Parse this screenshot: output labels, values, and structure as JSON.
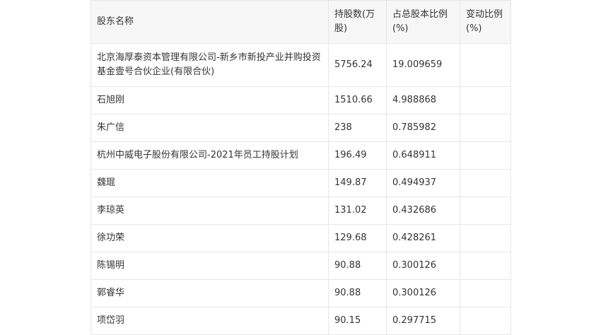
{
  "table": {
    "headers": [
      "股东名称",
      "持股数(万股)",
      "占总股本比例(%)",
      "变动比例(%)"
    ],
    "rows": [
      {
        "name": "北京海厚泰资本管理有限公司-新乡市新投产业并购投资基金壹号合伙企业(有限合伙)",
        "shares": "5756.24",
        "ratio": "19.009659",
        "change": ""
      },
      {
        "name": "石旭刚",
        "shares": "1510.66",
        "ratio": "4.988868",
        "change": ""
      },
      {
        "name": "朱广信",
        "shares": "238",
        "ratio": "0.785982",
        "change": ""
      },
      {
        "name": "杭州中威电子股份有限公司-2021年员工持股计划",
        "shares": "196.49",
        "ratio": "0.648911",
        "change": ""
      },
      {
        "name": "魏琨",
        "shares": "149.87",
        "ratio": "0.494937",
        "change": ""
      },
      {
        "name": "李琼英",
        "shares": "131.02",
        "ratio": "0.432686",
        "change": ""
      },
      {
        "name": "徐功荣",
        "shares": "129.68",
        "ratio": "0.428261",
        "change": ""
      },
      {
        "name": "陈锡明",
        "shares": "90.88",
        "ratio": "0.300126",
        "change": ""
      },
      {
        "name": "郭睿华",
        "shares": "90.88",
        "ratio": "0.300126",
        "change": ""
      },
      {
        "name": "项岱羽",
        "shares": "90.15",
        "ratio": "0.297715",
        "change": ""
      }
    ]
  }
}
